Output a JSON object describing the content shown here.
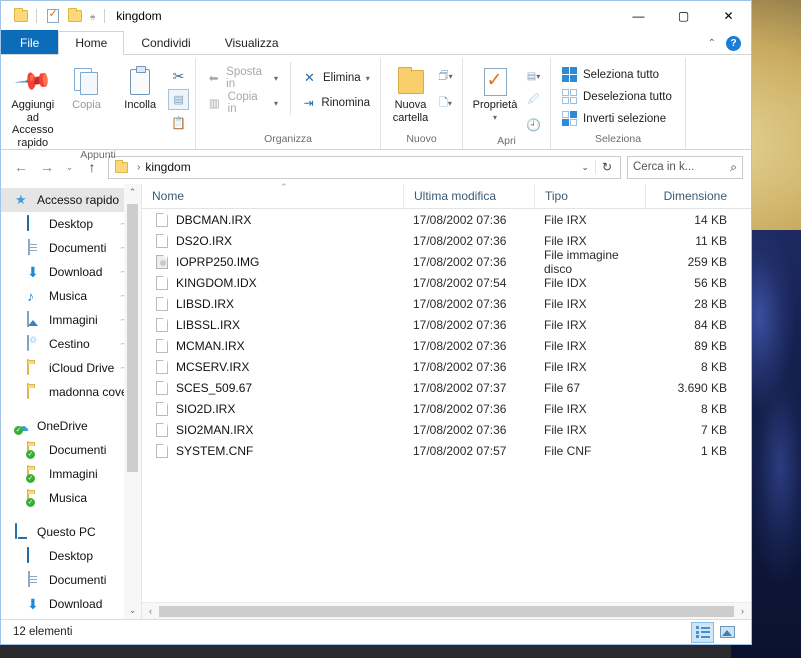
{
  "window": {
    "title": "kingdom",
    "quick_access": [
      "folder-icon",
      "properties-icon",
      "new-folder-icon",
      "customize-caret"
    ],
    "controls": {
      "minimize": "—",
      "maximize": "▢",
      "close": "✕"
    }
  },
  "ribbon": {
    "tabs": [
      {
        "label": "File",
        "kind": "file"
      },
      {
        "label": "Home",
        "kind": "active"
      },
      {
        "label": "Condividi",
        "kind": "plain"
      },
      {
        "label": "Visualizza",
        "kind": "plain"
      }
    ],
    "collapse_caret": "⌃",
    "help_label": "?",
    "groups": [
      {
        "label": "Appunti",
        "pin_button": "Aggiungi ad\nAccesso rapido",
        "pin_line1": "Aggiungi ad",
        "pin_line2": "Accesso rapido",
        "copy_label": "Copia",
        "paste_label": "Incolla",
        "small_icons": [
          "cut-icon",
          "copy-path-icon",
          "paste-shortcut-icon"
        ]
      },
      {
        "label": "Organizza",
        "items": [
          {
            "label": "Sposta in",
            "caret": "▾",
            "disabled": true
          },
          {
            "label": "Copia in",
            "caret": "▾",
            "disabled": true
          },
          {
            "label": "Elimina",
            "caret": "▾",
            "disabled": false
          },
          {
            "label": "Rinomina",
            "caret": "",
            "disabled": false
          }
        ]
      },
      {
        "label": "Nuovo",
        "new_folder_line1": "Nuova",
        "new_folder_line2": "cartella",
        "small_icons": [
          "new-item-icon",
          "easy-access-icon"
        ]
      },
      {
        "label": "Apri",
        "properties_label": "Proprietà",
        "properties_caret": "▾",
        "small_icons": [
          "open-with-icon",
          "edit-icon",
          "history-icon"
        ]
      },
      {
        "label": "Seleziona",
        "items": [
          {
            "label": "Seleziona tutto"
          },
          {
            "label": "Deseleziona tutto"
          },
          {
            "label": "Inverti selezione"
          }
        ]
      }
    ]
  },
  "address": {
    "back": "←",
    "forward": "→",
    "recent_caret": "⌄",
    "up": "↑",
    "breadcrumb_root_icon": "folder-icon",
    "breadcrumb_sep": "›",
    "breadcrumb": "kingdom",
    "dropdown_caret": "⌄",
    "refresh": "↻",
    "search_placeholder": "Cerca in k...",
    "search_value": "",
    "search_icon": "⌕"
  },
  "sidebar": {
    "items": [
      {
        "label": "Accesso rapido",
        "icon": "star-icon",
        "level": 0,
        "selected": true,
        "pinned": false
      },
      {
        "label": "Desktop",
        "icon": "desktop-icon",
        "level": 1,
        "selected": false,
        "pinned": true
      },
      {
        "label": "Documenti",
        "icon": "documents-icon",
        "level": 1,
        "selected": false,
        "pinned": true
      },
      {
        "label": "Download",
        "icon": "download-icon",
        "level": 1,
        "selected": false,
        "pinned": true
      },
      {
        "label": "Musica",
        "icon": "music-icon",
        "level": 1,
        "selected": false,
        "pinned": true
      },
      {
        "label": "Immagini",
        "icon": "pictures-icon",
        "level": 1,
        "selected": false,
        "pinned": true
      },
      {
        "label": "Cestino",
        "icon": "recycle-bin-icon",
        "level": 1,
        "selected": false,
        "pinned": true
      },
      {
        "label": "iCloud Drive",
        "icon": "folder-icon",
        "level": 1,
        "selected": false,
        "pinned": true
      },
      {
        "label": "madonna cover",
        "icon": "folder-icon",
        "level": 1,
        "selected": false,
        "pinned": false
      },
      {
        "label": "OneDrive",
        "icon": "onedrive-icon",
        "level": 0,
        "selected": false,
        "pinned": false,
        "gap_before": true
      },
      {
        "label": "Documenti",
        "icon": "folder-sync-icon",
        "level": 1,
        "selected": false,
        "pinned": false
      },
      {
        "label": "Immagini",
        "icon": "folder-sync-icon",
        "level": 1,
        "selected": false,
        "pinned": false
      },
      {
        "label": "Musica",
        "icon": "folder-sync-icon",
        "level": 1,
        "selected": false,
        "pinned": false
      },
      {
        "label": "Questo PC",
        "icon": "this-pc-icon",
        "level": 0,
        "selected": false,
        "pinned": false,
        "gap_before": true
      },
      {
        "label": "Desktop",
        "icon": "desktop-icon",
        "level": 1,
        "selected": false,
        "pinned": false
      },
      {
        "label": "Documenti",
        "icon": "documents-icon",
        "level": 1,
        "selected": false,
        "pinned": false
      },
      {
        "label": "Download",
        "icon": "download-icon",
        "level": 1,
        "selected": false,
        "pinned": false
      }
    ],
    "scroll_up": "⌃",
    "scroll_down": "⌄"
  },
  "filelist": {
    "columns": [
      {
        "key": "name",
        "label": "Nome",
        "sorted": true,
        "sort_dir": "asc"
      },
      {
        "key": "modified",
        "label": "Ultima modifica"
      },
      {
        "key": "type",
        "label": "Tipo"
      },
      {
        "key": "size",
        "label": "Dimensione"
      }
    ],
    "sort_glyph": "⌃",
    "rows": [
      {
        "name": "DBCMAN.IRX",
        "modified": "17/08/2002 07:36",
        "type": "File IRX",
        "size": "14 KB",
        "icon": "file-icon"
      },
      {
        "name": "DS2O.IRX",
        "modified": "17/08/2002 07:36",
        "type": "File IRX",
        "size": "11 KB",
        "icon": "file-icon"
      },
      {
        "name": "IOPRP250.IMG",
        "modified": "17/08/2002 07:36",
        "type": "File immagine disco",
        "size": "259 KB",
        "icon": "disc-image-icon"
      },
      {
        "name": "KINGDOM.IDX",
        "modified": "17/08/2002 07:54",
        "type": "File IDX",
        "size": "56 KB",
        "icon": "file-icon"
      },
      {
        "name": "LIBSD.IRX",
        "modified": "17/08/2002 07:36",
        "type": "File IRX",
        "size": "28 KB",
        "icon": "file-icon"
      },
      {
        "name": "LIBSSL.IRX",
        "modified": "17/08/2002 07:36",
        "type": "File IRX",
        "size": "84 KB",
        "icon": "file-icon"
      },
      {
        "name": "MCMAN.IRX",
        "modified": "17/08/2002 07:36",
        "type": "File IRX",
        "size": "89 KB",
        "icon": "file-icon"
      },
      {
        "name": "MCSERV.IRX",
        "modified": "17/08/2002 07:36",
        "type": "File IRX",
        "size": "8 KB",
        "icon": "file-icon"
      },
      {
        "name": "SCES_509.67",
        "modified": "17/08/2002 07:37",
        "type": "File 67",
        "size": "3.690 KB",
        "icon": "file-icon"
      },
      {
        "name": "SIO2D.IRX",
        "modified": "17/08/2002 07:36",
        "type": "File IRX",
        "size": "8 KB",
        "icon": "file-icon"
      },
      {
        "name": "SIO2MAN.IRX",
        "modified": "17/08/2002 07:36",
        "type": "File IRX",
        "size": "7 KB",
        "icon": "file-icon"
      },
      {
        "name": "SYSTEM.CNF",
        "modified": "17/08/2002 07:57",
        "type": "File CNF",
        "size": "1 KB",
        "icon": "file-icon"
      }
    ],
    "hscroll_left": "‹",
    "hscroll_right": "›"
  },
  "statusbar": {
    "item_count": "12 elementi",
    "views": [
      {
        "name": "details-view",
        "active": true
      },
      {
        "name": "large-icons-view",
        "active": false
      }
    ]
  }
}
